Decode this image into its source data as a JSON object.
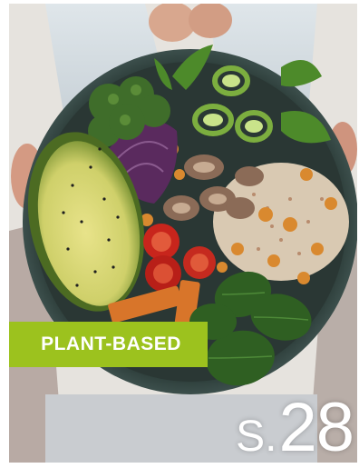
{
  "badge": {
    "label": "PLANT-BASED",
    "color": "#9cc21e"
  },
  "page": {
    "prefix": "S.",
    "number": "28"
  },
  "image": {
    "subject": "buddha-bowl-photo"
  }
}
